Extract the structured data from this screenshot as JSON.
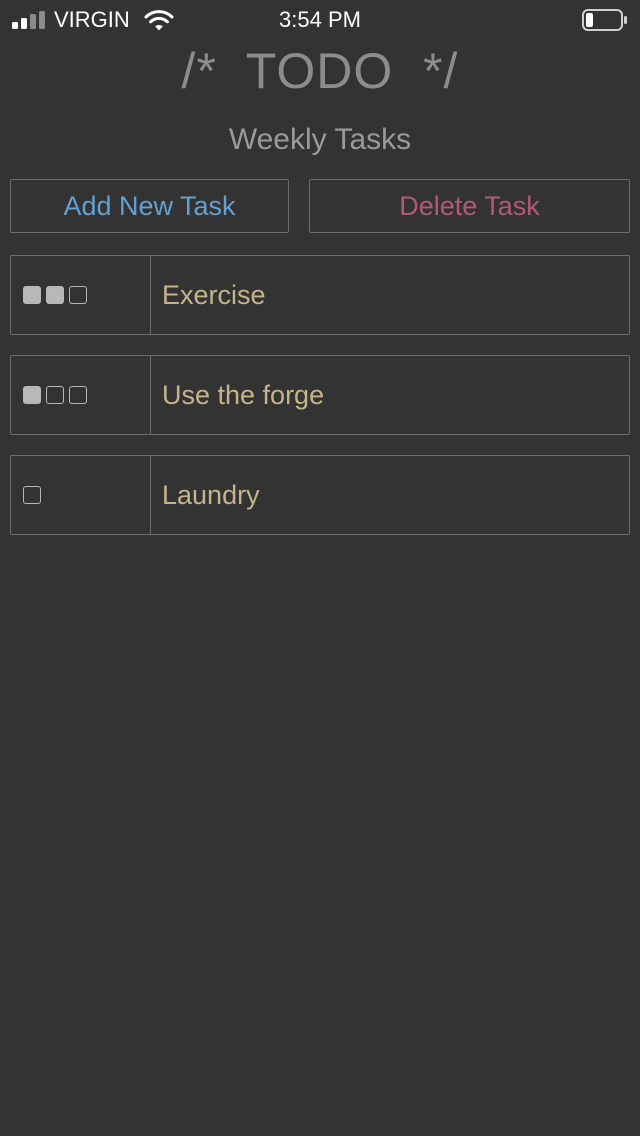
{
  "status_bar": {
    "carrier": "VIRGIN",
    "time": "3:54 PM",
    "signal_bars_filled": 2,
    "signal_bars_total": 4,
    "battery_level": 0.2
  },
  "header": {
    "title": "/*  TODO  */",
    "subtitle": "Weekly Tasks"
  },
  "actions": {
    "add_label": "Add New Task",
    "delete_label": "Delete Task"
  },
  "tasks": [
    {
      "label": "Exercise",
      "checks": [
        true,
        true,
        false
      ]
    },
    {
      "label": "Use the forge",
      "checks": [
        true,
        false,
        false
      ]
    },
    {
      "label": "Laundry",
      "checks": [
        false
      ]
    }
  ],
  "colors": {
    "background": "#333333",
    "add_button_text": "#64a0d2",
    "delete_button_text": "#b4587a",
    "task_text": "#c4b489",
    "title_text": "#8c8c8c"
  },
  "icons": {
    "signal": "cellular-signal-icon",
    "wifi": "wifi-icon",
    "battery": "battery-icon",
    "checkbox": "checkbox-icon"
  }
}
